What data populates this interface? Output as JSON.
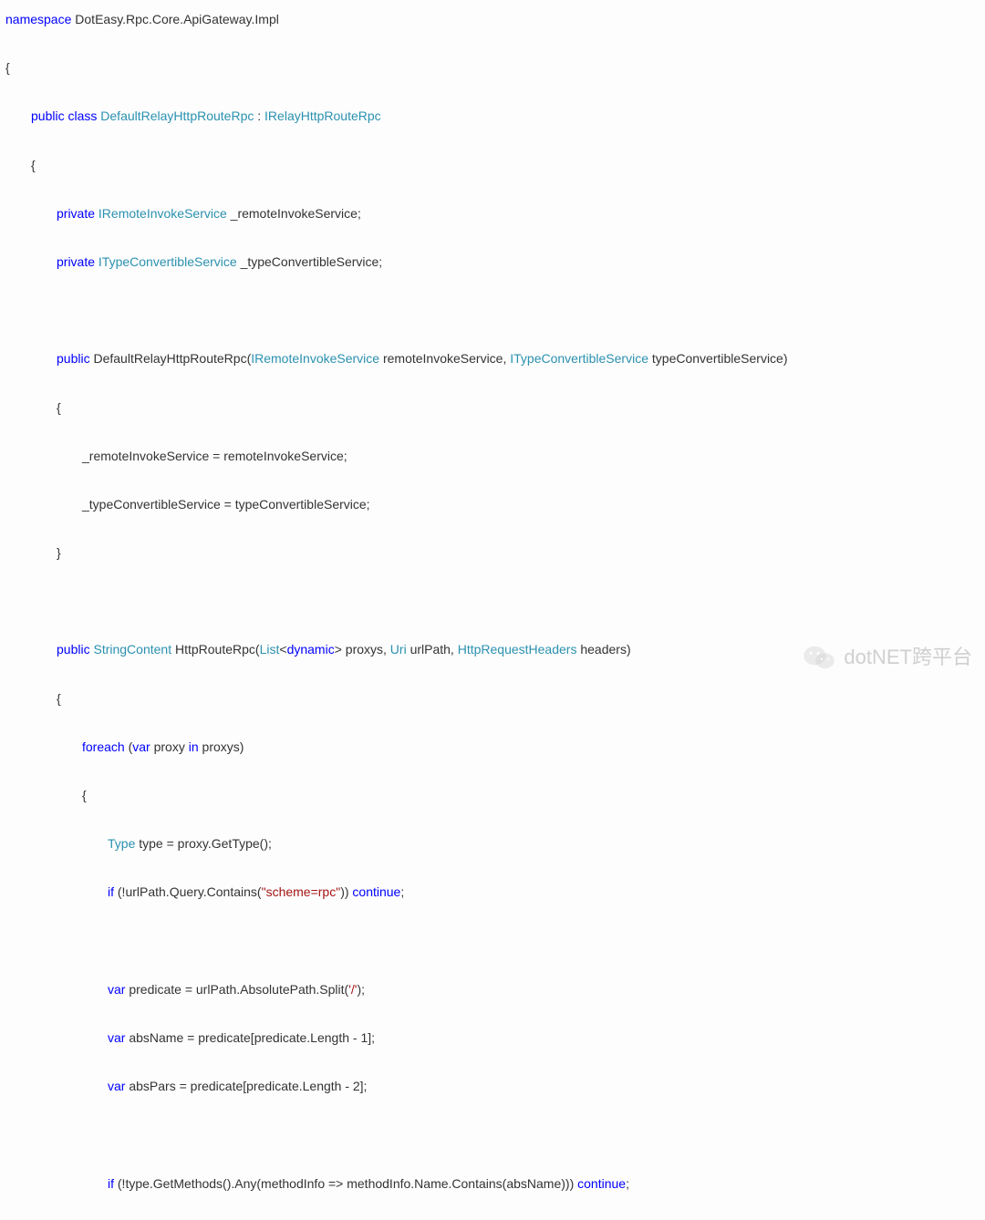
{
  "code": {
    "l01_kw": "namespace",
    "l01_ns": "DotEasy.Rpc.Core.ApiGateway.Impl",
    "l02_brace": "{",
    "l03_kw_public": "public",
    "l03_kw_class": "class",
    "l03_classname": "DefaultRelayHttpRouteRpc",
    "l03_colon": " : ",
    "l03_iface": "IRelayHttpRouteRpc",
    "l04_brace": "{",
    "l05_kw_private": "private",
    "l05_type": "IRemoteInvokeService",
    "l05_field": "_remoteInvokeService;",
    "l06_kw_private": "private",
    "l06_type": "ITypeConvertibleService",
    "l06_field": "_typeConvertibleService;",
    "l08_kw_public": "public",
    "l08_ctor": "DefaultRelayHttpRouteRpc(",
    "l08_ptype1": "IRemoteInvokeService",
    "l08_p1": " remoteInvokeService, ",
    "l08_ptype2": "ITypeConvertibleService",
    "l08_p2": " typeConvertibleService)",
    "l09_brace": "{",
    "l10_body": "_remoteInvokeService = remoteInvokeService;",
    "l11_body": "_typeConvertibleService = typeConvertibleService;",
    "l12_brace": "}",
    "l14_kw_public": "public",
    "l14_ret": "StringContent",
    "l14_name": " HttpRouteRpc(",
    "l14_list": "List",
    "l14_lt": "<",
    "l14_dyn": "dynamic",
    "l14_gt": ">",
    "l14_rest_a": " proxys, ",
    "l14_uri": "Uri",
    "l14_rest_b": " urlPath, ",
    "l14_hdr": "HttpRequestHeaders",
    "l14_rest_c": " headers)",
    "l15_brace": "{",
    "l16_kw_foreach": "foreach",
    "l16_open": " (",
    "l16_kw_var": "var",
    "l16_mid": " proxy ",
    "l16_kw_in": "in",
    "l16_end": " proxys)",
    "l17_brace": "{",
    "l18_type": "Type",
    "l18_rest": " type = proxy.GetType();",
    "l19_kw_if": "if",
    "l19_a": " (!urlPath.Query.Contains(",
    "l19_str": "\"scheme=rpc\"",
    "l19_b": ")) ",
    "l19_kw_continue": "continue",
    "l19_semi": ";",
    "l21_kw_var": "var",
    "l21_a": " predicate = urlPath.AbsolutePath.Split(",
    "l21_str": "'/'",
    "l21_b": ");",
    "l22_kw_var": "var",
    "l22_rest": " absName = predicate[predicate.Length - 1];",
    "l23_kw_var": "var",
    "l23_rest": " absPars = predicate[predicate.Length - 2];",
    "l25_kw_if": "if",
    "l25_rest_a": " (!type.GetMethods().Any(methodInfo => methodInfo.Name.Contains(absName))) ",
    "l25_kw_continue": "continue",
    "l25_semi": ";"
  },
  "watermark": {
    "text": "dotNET跨平台",
    "icon_name": "wechat-icon"
  }
}
